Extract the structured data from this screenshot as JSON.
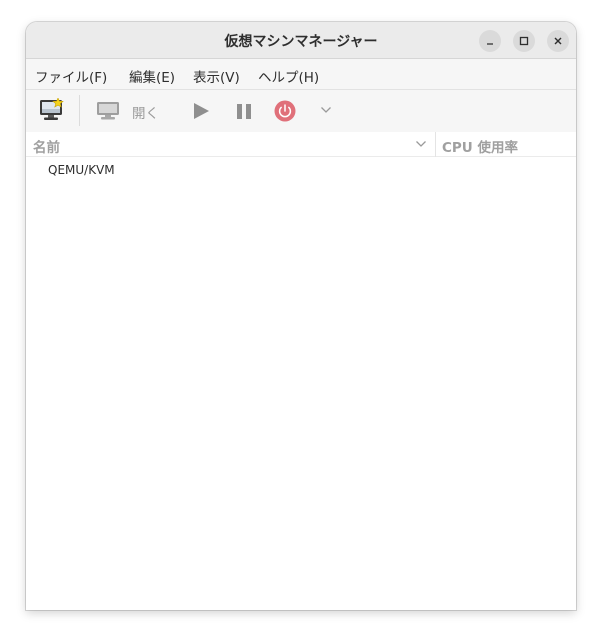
{
  "window": {
    "title": "仮想マシンマネージャー"
  },
  "menu": {
    "file": "ファイル(F)",
    "edit": "編集(E)",
    "view": "表示(V)",
    "help": "ヘルプ(H)"
  },
  "toolbar": {
    "new_vm_icon": "new-vm-icon",
    "console_icon": "monitor-icon",
    "open_label": "開く",
    "run_icon": "play-icon",
    "pause_icon": "pause-icon",
    "shutdown_icon": "power-icon",
    "shutdown_menu_icon": "chevron-down-icon"
  },
  "columns": {
    "name": "名前",
    "cpu": "CPU 使用率"
  },
  "connections": [
    {
      "name": "QEMU/KVM"
    }
  ],
  "colors": {
    "titlebar": "#ebebeb",
    "toolbar": "#f6f6f6",
    "shutdown_accent": "#e0707a",
    "disabled_text": "#9a9a9a"
  }
}
